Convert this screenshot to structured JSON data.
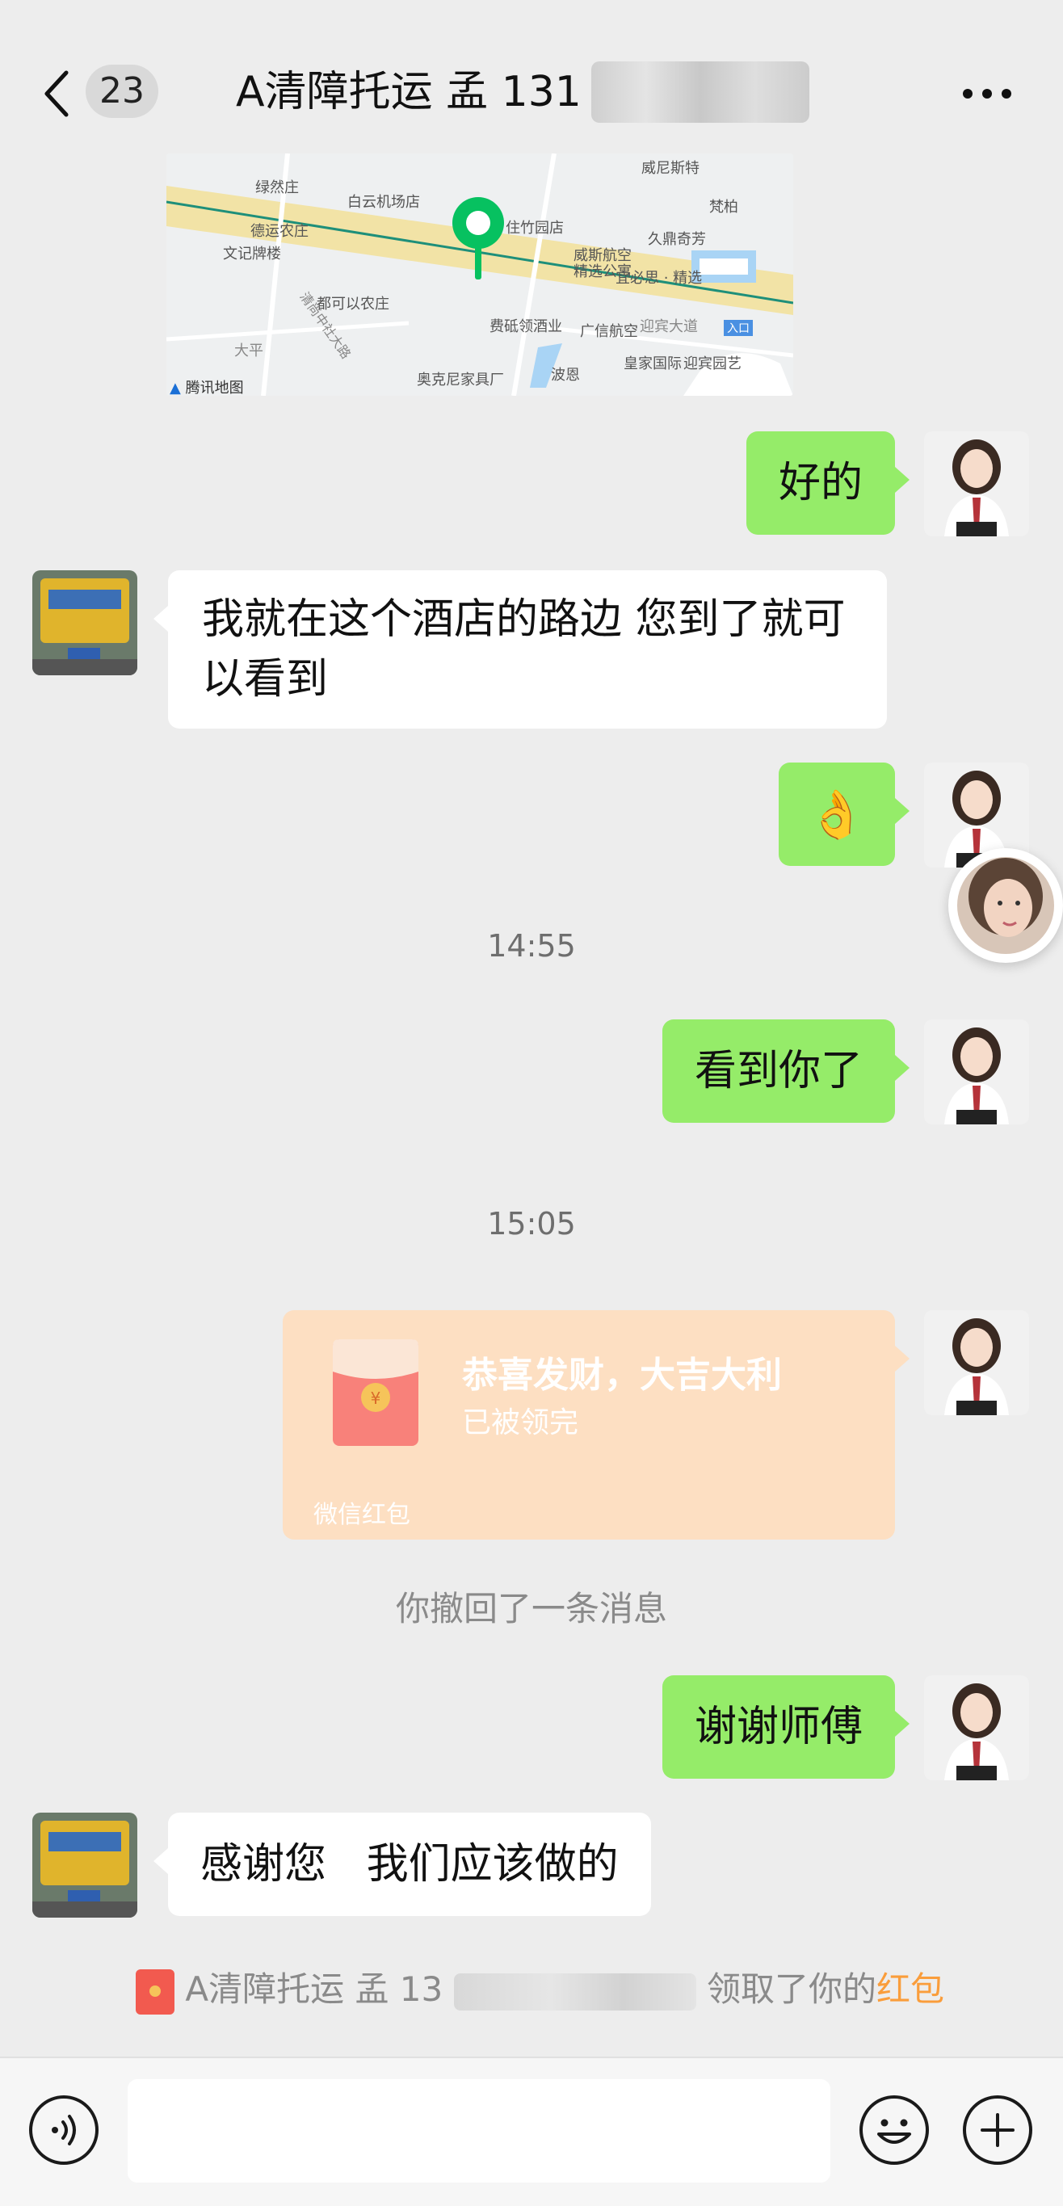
{
  "header": {
    "back_label": "返回",
    "unread_count": "23",
    "chat_title": "A清障托运 孟  131",
    "more_icon": "more-icon"
  },
  "map": {
    "attribution": "腾讯地图",
    "labels": [
      "威尼斯特",
      "绿然庄",
      "白云机场店",
      "住竹园店",
      "梵柏",
      "久鼎奇芳",
      "德运农庄",
      "威斯航空",
      "文记牌楼",
      "精选公寓",
      "宜必思 · 精选",
      "都可以农庄",
      "费砥领酒业",
      "广信航空",
      "迎宾大道",
      "迎宾园艺",
      "大平",
      "波恩",
      "皇家国际",
      "奥克尼家具厂",
      "清尚中社大路",
      "入口"
    ],
    "road_color": "#f2e3a6"
  },
  "messages": [
    {
      "side": "right",
      "type": "text",
      "text": "好的"
    },
    {
      "side": "left",
      "type": "text",
      "text": "我就在这个酒店的路边  您到了就可以看到"
    },
    {
      "side": "right",
      "type": "emoji",
      "emoji": "👌"
    },
    {
      "type": "time",
      "text": "14:55"
    },
    {
      "side": "right",
      "type": "text",
      "text": "看到你了"
    },
    {
      "type": "time",
      "text": "15:05"
    },
    {
      "side": "right",
      "type": "redpacket",
      "title": "恭喜发财，大吉大利",
      "status": "已被领完",
      "footer": "微信红包"
    },
    {
      "type": "system",
      "text": "你撤回了一条消息"
    },
    {
      "side": "right",
      "type": "text",
      "text": "谢谢师傅"
    },
    {
      "side": "left",
      "type": "text",
      "text": "感谢您   我们应该做的"
    }
  ],
  "system_notice": {
    "prefix": "A清障托运 孟  13",
    "middle": "领取了你的",
    "link": "红包",
    "link_color": "#fa9d3b"
  },
  "colors": {
    "self_bubble": "#95ec69",
    "other_bubble": "#ffffff",
    "redpacket_bg": "#fddfc2",
    "map_marker": "#07c160"
  },
  "bottom": {
    "voice_icon": "voice-icon",
    "emoji_icon": "emoji-icon",
    "add_icon": "add-icon"
  }
}
